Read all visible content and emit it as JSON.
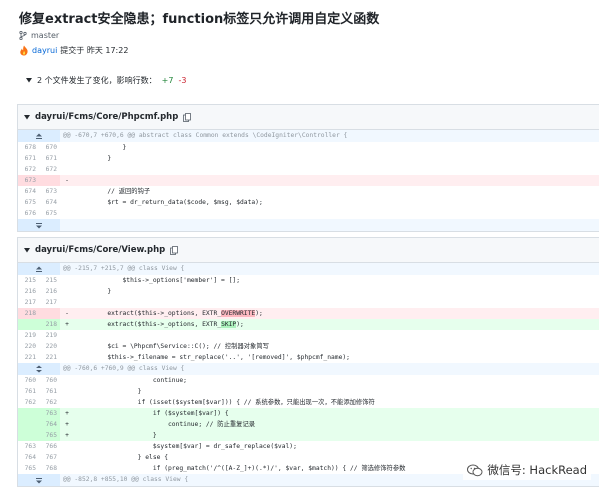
{
  "commit": {
    "title": "修复extract安全隐患；function标签只允许调用自定义函数",
    "branch": "master",
    "author": "dayrui",
    "committed_text": "提交于 昨天 17:22"
  },
  "summary": {
    "text": "2 个文件发生了变化，影响行数：",
    "additions": "+7",
    "deletions": "-3"
  },
  "files": [
    {
      "path": "dayrui/Fcms/Core/Phpcmf.php",
      "hunk_header": "@@ -670,7 +670,6 @@ abstract class Common extends \\CodeIgniter\\Controller {",
      "lines": [
        {
          "old": "678",
          "new": "670",
          "sign": " ",
          "type": "ctx",
          "code": "            }"
        },
        {
          "old": "671",
          "new": "671",
          "sign": " ",
          "type": "ctx",
          "code": "        }"
        },
        {
          "old": "672",
          "new": "672",
          "sign": " ",
          "type": "ctx",
          "code": ""
        },
        {
          "old": "673",
          "new": "",
          "sign": "-",
          "type": "del",
          "code": ""
        },
        {
          "old": "674",
          "new": "673",
          "sign": " ",
          "type": "ctx",
          "code": "        // 返回的钩子"
        },
        {
          "old": "675",
          "new": "674",
          "sign": " ",
          "type": "ctx",
          "code": "        $rt = dr_return_data($code, $msg, $data);"
        },
        {
          "old": "676",
          "new": "675",
          "sign": " ",
          "type": "ctx",
          "code": ""
        }
      ]
    },
    {
      "path": "dayrui/Fcms/Core/View.php",
      "hunk_header": "@@ -215,7 +215,7 @@ class View {",
      "hunk_header_2": "@@ -760,6 +760,9 @@ class View {",
      "hunk_header_3": "@@ -852,8 +855,10 @@ class View {",
      "lines": [
        {
          "old": "215",
          "new": "215",
          "sign": " ",
          "type": "ctx",
          "code": "            $this->_options['member'] = [];"
        },
        {
          "old": "216",
          "new": "216",
          "sign": " ",
          "type": "ctx",
          "code": "        }"
        },
        {
          "old": "217",
          "new": "217",
          "sign": " ",
          "type": "ctx",
          "code": ""
        },
        {
          "old": "218",
          "new": "",
          "sign": "-",
          "type": "del",
          "code_pre": "        extract($this->_options, EXTR_",
          "code_hl": "OVERWRITE",
          "code_post": ");"
        },
        {
          "old": "",
          "new": "218",
          "sign": "+",
          "type": "add",
          "code_pre": "        extract($this->_options, EXTR_",
          "code_hl": "SKIP",
          "code_post": ");"
        },
        {
          "old": "219",
          "new": "219",
          "sign": " ",
          "type": "ctx",
          "code": ""
        },
        {
          "old": "220",
          "new": "220",
          "sign": " ",
          "type": "ctx",
          "code": "        $ci = \\Phpcmf\\Service::C(); // 控制器对象简写"
        },
        {
          "old": "221",
          "new": "221",
          "sign": " ",
          "type": "ctx",
          "code": "        $this->_filename = str_replace('..', '[removed]', $phpcmf_name);"
        }
      ],
      "lines2": [
        {
          "old": "760",
          "new": "760",
          "sign": " ",
          "type": "ctx",
          "code": "                    continue;"
        },
        {
          "old": "761",
          "new": "761",
          "sign": " ",
          "type": "ctx",
          "code": "                }"
        },
        {
          "old": "762",
          "new": "762",
          "sign": " ",
          "type": "ctx",
          "code": "                if (isset($system[$var])) { // 系统参数，只能出现一次，不能添加修饰符"
        },
        {
          "old": "",
          "new": "763",
          "sign": "+",
          "type": "add",
          "code": "                    if ($system[$var]) {"
        },
        {
          "old": "",
          "new": "764",
          "sign": "+",
          "type": "add",
          "code": "                        continue; // 防止重复记录"
        },
        {
          "old": "",
          "new": "765",
          "sign": "+",
          "type": "add",
          "code": "                    }"
        },
        {
          "old": "763",
          "new": "766",
          "sign": " ",
          "type": "ctx",
          "code": "                    $system[$var] = dr_safe_replace($val);"
        },
        {
          "old": "764",
          "new": "767",
          "sign": " ",
          "type": "ctx",
          "code": "                } else {"
        },
        {
          "old": "765",
          "new": "768",
          "sign": " ",
          "type": "ctx",
          "code": "                    if (preg_match('/^([A-Z_]+)(.*)/', $var, $match)) { // 筛选修饰符参数"
        }
      ]
    }
  ],
  "watermark": "微信号: HackRead",
  "icons": {
    "branch": "branch-icon",
    "author": "flame-avatar-icon",
    "copy": "copy-icon",
    "expand_up": "expand-up-icon",
    "expand_down": "expand-down-icon",
    "caret": "caret-down-icon",
    "wechat": "wechat-icon"
  },
  "colors": {
    "add_bg": "#e6ffed",
    "del_bg": "#ffeef0",
    "hunk_bg": "#f1f8ff",
    "link": "#0366d6"
  }
}
